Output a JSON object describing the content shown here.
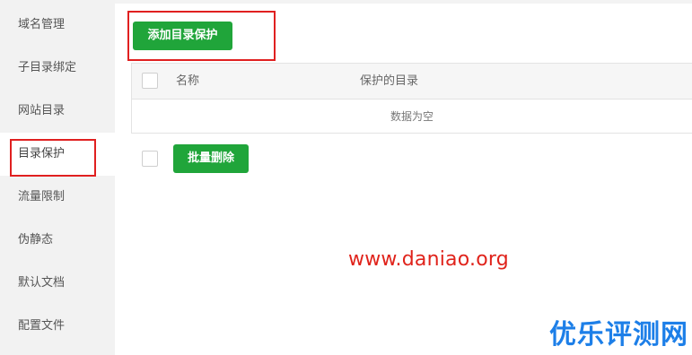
{
  "sidebar": {
    "items": [
      {
        "label": "域名管理"
      },
      {
        "label": "子目录绑定"
      },
      {
        "label": "网站目录"
      },
      {
        "label": "目录保护"
      },
      {
        "label": "流量限制"
      },
      {
        "label": "伪静态"
      },
      {
        "label": "默认文档"
      },
      {
        "label": "配置文件"
      }
    ],
    "active_index": 3
  },
  "toolbar": {
    "add_button_label": "添加目录保护"
  },
  "table": {
    "columns": [
      "名称",
      "保护的目录"
    ],
    "empty_text": "数据为空"
  },
  "footer": {
    "batch_delete_label": "批量删除"
  },
  "watermark": {
    "url": "www.daniao.org",
    "brand": "优乐评测网"
  },
  "colors": {
    "accent_green": "#20a53a",
    "highlight_red": "#e02020",
    "watermark_red": "#e0231b",
    "watermark_blue": "#1d7fe8"
  }
}
